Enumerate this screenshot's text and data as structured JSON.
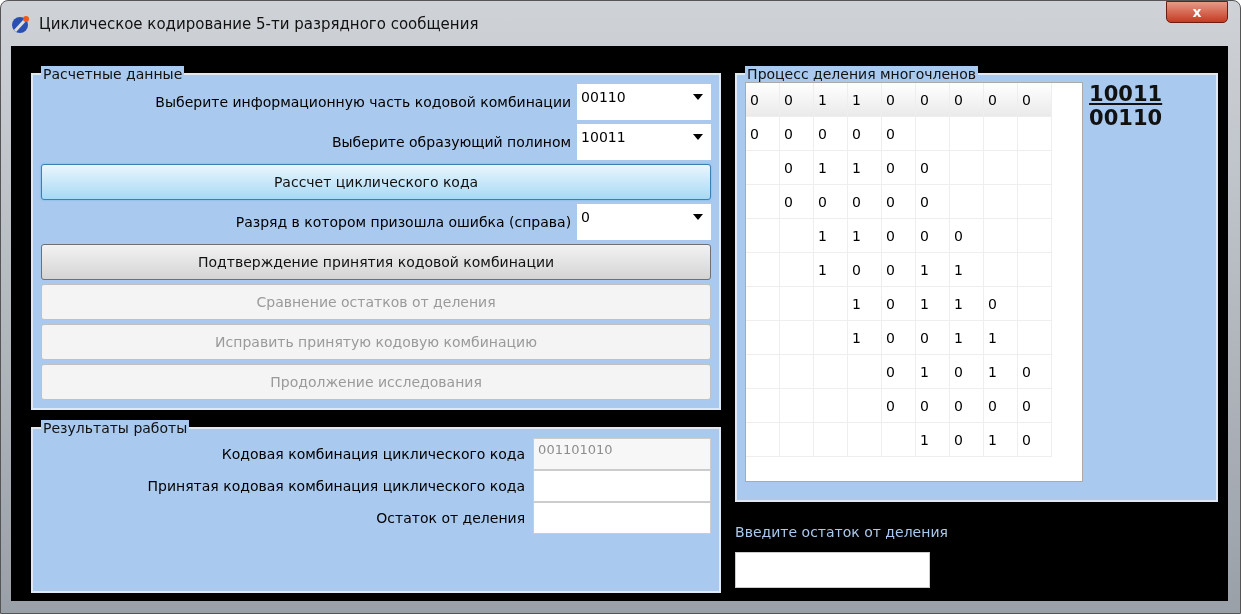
{
  "window": {
    "title": "Циклическое кодирование 5-ти разрядного сообщения",
    "close": "x"
  },
  "input_panel": {
    "title": "Расчетные данные",
    "fields": [
      {
        "label": "Выберите информационную часть кодовой комбинации",
        "value": "00110"
      },
      {
        "label": "Выберите образующий  полином",
        "value": "10011"
      }
    ],
    "calc_button": {
      "label": "Рассчет циклического кода",
      "highlighted": true,
      "disabled": false
    },
    "error_field": {
      "label": "Разряд в котором призошла ошибка (справа)",
      "value": "0"
    },
    "buttons": [
      {
        "label": "Подтверждение принятия кодовой комбинации",
        "disabled": false
      },
      {
        "label": "Сравнение остатков от деления",
        "disabled": true
      },
      {
        "label": "Исправить принятую кодовую комбинацию",
        "disabled": true
      },
      {
        "label": "Продолжение исследования",
        "disabled": true
      }
    ]
  },
  "results_panel": {
    "title": "Результаты работы",
    "fields": [
      {
        "label": "Кодовая комбинация циклического кода",
        "value": "001101010",
        "disabled": true
      },
      {
        "label": "Принятая кодовая комбинация циклического кода"
      },
      {
        "label": "Остаток от деления"
      }
    ]
  },
  "division_panel": {
    "title": "Процесс деления многочленов",
    "grid": [
      [
        {
          "kind": "digit",
          "text": "0"
        },
        {
          "kind": "digit",
          "text": "0"
        },
        {
          "kind": "digit",
          "text": "1"
        },
        {
          "kind": "digit",
          "text": "1"
        },
        {
          "kind": "digit",
          "text": "0"
        },
        {
          "kind": "digit",
          "text": "0"
        },
        {
          "kind": "digit",
          "text": "0"
        },
        {
          "kind": "digit",
          "text": "0"
        },
        {
          "kind": "digit",
          "text": "0"
        }
      ],
      [
        {
          "kind": "digit",
          "text": "0"
        },
        {
          "kind": "digit",
          "text": "0"
        },
        {
          "kind": "digit",
          "text": "0"
        },
        {
          "kind": "digit",
          "text": "0"
        },
        {
          "kind": "digit",
          "text": "0"
        },
        {
          "kind": "blank"
        },
        {
          "kind": "blank"
        },
        {
          "kind": "blank"
        },
        {
          "kind": "blank"
        }
      ],
      [
        {
          "kind": "blank"
        },
        {
          "kind": "digit",
          "text": "0"
        },
        {
          "kind": "digit",
          "text": "1"
        },
        {
          "kind": "digit",
          "text": "1"
        },
        {
          "kind": "digit",
          "text": "0"
        },
        {
          "kind": "digit",
          "text": "0"
        },
        {
          "kind": "blank"
        },
        {
          "kind": "blank"
        },
        {
          "kind": "blank"
        }
      ],
      [
        {
          "kind": "blank"
        },
        {
          "kind": "digit",
          "text": "0"
        },
        {
          "kind": "digit",
          "text": "0"
        },
        {
          "kind": "digit",
          "text": "0"
        },
        {
          "kind": "digit",
          "text": "0"
        },
        {
          "kind": "digit",
          "text": "0"
        },
        {
          "kind": "blank"
        },
        {
          "kind": "blank"
        },
        {
          "kind": "blank"
        }
      ],
      [
        {
          "kind": "blank"
        },
        {
          "kind": "blank"
        },
        {
          "kind": "digit",
          "text": "1"
        },
        {
          "kind": "digit",
          "text": "1"
        },
        {
          "kind": "digit",
          "text": "0"
        },
        {
          "kind": "digit",
          "text": "0"
        },
        {
          "kind": "digit",
          "text": "0"
        },
        {
          "kind": "blank"
        },
        {
          "kind": "blank"
        }
      ],
      [
        {
          "kind": "blank"
        },
        {
          "kind": "blank"
        },
        {
          "kind": "digit",
          "text": "1"
        },
        {
          "kind": "digit",
          "text": "0"
        },
        {
          "kind": "digit",
          "text": "0"
        },
        {
          "kind": "digit",
          "text": "1"
        },
        {
          "kind": "digit",
          "text": "1"
        },
        {
          "kind": "blank"
        },
        {
          "kind": "blank"
        }
      ],
      [
        {
          "kind": "blank"
        },
        {
          "kind": "blank"
        },
        {
          "kind": "blank"
        },
        {
          "kind": "digit",
          "text": "1"
        },
        {
          "kind": "digit",
          "text": "0"
        },
        {
          "kind": "digit",
          "text": "1"
        },
        {
          "kind": "digit",
          "text": "1"
        },
        {
          "kind": "digit",
          "text": "0"
        },
        {
          "kind": "blank"
        }
      ],
      [
        {
          "kind": "blank"
        },
        {
          "kind": "blank"
        },
        {
          "kind": "blank"
        },
        {
          "kind": "digit",
          "text": "1"
        },
        {
          "kind": "digit",
          "text": "0"
        },
        {
          "kind": "digit",
          "text": "0"
        },
        {
          "kind": "digit",
          "text": "1"
        },
        {
          "kind": "digit",
          "text": "1"
        },
        {
          "kind": "blank"
        }
      ],
      [
        {
          "kind": "blank"
        },
        {
          "kind": "blank"
        },
        {
          "kind": "blank"
        },
        {
          "kind": "blank"
        },
        {
          "kind": "digit",
          "text": "0"
        },
        {
          "kind": "digit",
          "text": "1"
        },
        {
          "kind": "digit",
          "text": "0"
        },
        {
          "kind": "digit",
          "text": "1"
        },
        {
          "kind": "digit",
          "text": "0"
        }
      ],
      [
        {
          "kind": "blank"
        },
        {
          "kind": "blank"
        },
        {
          "kind": "blank"
        },
        {
          "kind": "blank"
        },
        {
          "kind": "digit",
          "text": "0"
        },
        {
          "kind": "digit",
          "text": "0"
        },
        {
          "kind": "digit",
          "text": "0"
        },
        {
          "kind": "digit",
          "text": "0"
        },
        {
          "kind": "digit",
          "text": "0"
        }
      ],
      [
        {
          "kind": "blank"
        },
        {
          "kind": "blank"
        },
        {
          "kind": "blank"
        },
        {
          "kind": "blank"
        },
        {
          "kind": "blank"
        },
        {
          "kind": "digit",
          "text": "1"
        },
        {
          "kind": "digit",
          "text": "0"
        },
        {
          "kind": "digit",
          "text": "1"
        },
        {
          "kind": "digit",
          "text": "0"
        }
      ]
    ],
    "divisor": "10011",
    "quotient": "00110"
  },
  "remainder_input": {
    "label": "Введите остаток от деления"
  }
}
